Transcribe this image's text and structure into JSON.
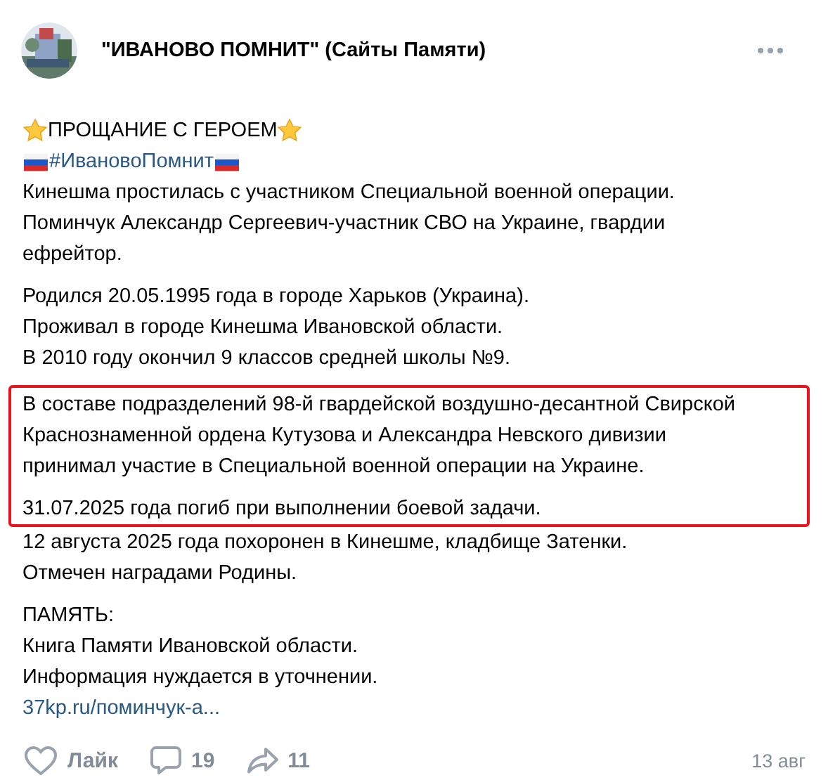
{
  "group": {
    "name": "\"ИВАНОВО ПОМНИТ\" (Сайты Памяти)"
  },
  "post": {
    "title": "ПРОЩАНИЕ С ГЕРОЕМ",
    "hashtag": "#ИвановоПомнит",
    "sections": [
      {
        "highlighted": false,
        "paragraphs": [
          [
            "Кинешма простилась с участником Специальной военной операции.",
            "Поминчук Александр Сергеевич-участник СВО на Украине, гвардии",
            "ефрейтор."
          ],
          [
            "Родился 20.05.1995 года в городе Харьков (Украина).",
            "Проживал в городе Кинешма Ивановской области.",
            "В 2010 году окончил 9 классов средней школы №9."
          ]
        ]
      },
      {
        "highlighted": true,
        "paragraphs": [
          [
            "В составе подразделений 98-й гвардейской воздушно-десантной Свирской",
            "Краснознаменной ордена Кутузова и Александра Невского дивизии",
            "принимал участие в Специальной военной операции на Украине."
          ],
          [
            "31.07.2025 года погиб при выполнении боевой задачи."
          ]
        ]
      },
      {
        "highlighted": false,
        "paragraphs": [
          [
            "12 августа 2025 года похоронен в Кинешме, кладбище Затенки.",
            "Отмечен наградами Родины."
          ],
          [
            "ПАМЯТЬ:",
            "Книга Памяти Ивановской области.",
            "Информация нуждается в уточнении."
          ]
        ]
      }
    ],
    "link": "37kp.ru/поминчук-а..."
  },
  "actions": {
    "like": "Лайк",
    "comments": "19",
    "shares": "11"
  },
  "date": "13 авг"
}
